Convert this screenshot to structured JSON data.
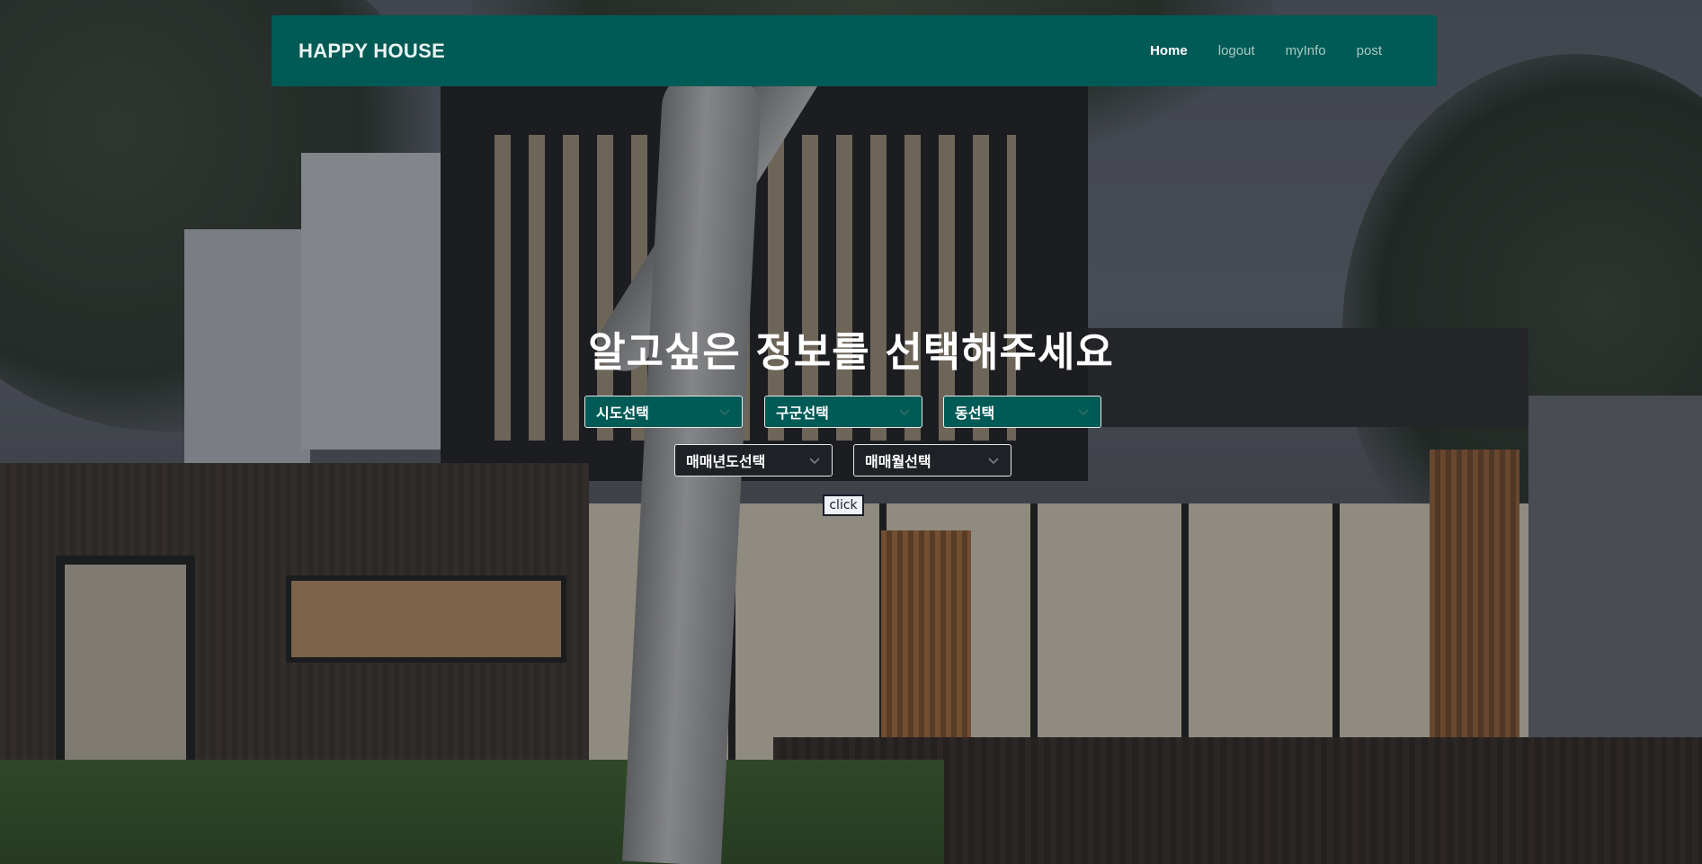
{
  "header": {
    "brand": "HAPPY HOUSE",
    "nav": [
      "Home",
      "logout",
      "myInfo",
      "post"
    ],
    "active": "Home"
  },
  "main": {
    "headline": "알고싶은 정보를 선택해주세요",
    "selects": {
      "sido": "시도선택",
      "gugun": "구군선택",
      "dong": "동선택",
      "year": "매매년도선택",
      "month": "매매월선택"
    },
    "click_label": "click"
  },
  "colors": {
    "navbar_bg": "#005a55",
    "select_teal": "#005a55",
    "select_dark": "#1e2226"
  },
  "icons": {
    "dropdown": "chevron-down-icon"
  }
}
